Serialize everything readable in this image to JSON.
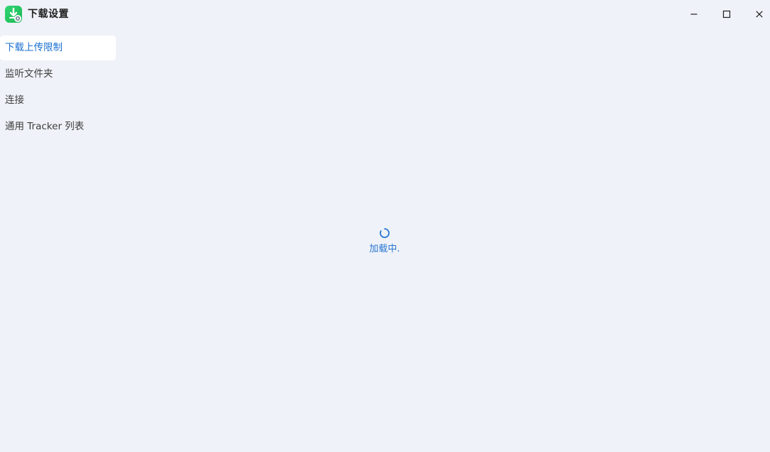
{
  "window": {
    "title": "下载设置",
    "icon": "download-settings-app-icon",
    "controls": [
      "minimize-icon",
      "maximize-icon",
      "close-icon"
    ]
  },
  "sidebar": {
    "items": [
      {
        "label": "下载上传限制",
        "active": true
      },
      {
        "label": "监听文件夹",
        "active": false
      },
      {
        "label": "连接",
        "active": false
      },
      {
        "label": "通用 Tracker 列表",
        "active": false
      }
    ]
  },
  "main": {
    "loading_text": "加载中.",
    "spinner_icon": "loading-spinner-icon"
  },
  "colors": {
    "background": "#eff2f8",
    "accent": "#1a6fd1",
    "app_icon": "#1db954",
    "active_item_bg": "#ffffff"
  }
}
